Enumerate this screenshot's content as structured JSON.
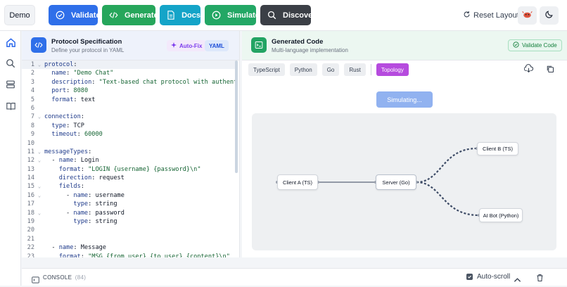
{
  "toolbar": {
    "demo_label": "Demo",
    "validate_label": "Validate",
    "generate_label": "Generate",
    "docs_label": "Docs",
    "simulate_label": "Simulate",
    "discover_label": "Discover",
    "reset_layout_label": "Reset Layout"
  },
  "sidebar": {
    "items": [
      "home-icon",
      "search-icon",
      "server-icon",
      "book-icon"
    ]
  },
  "left_panel": {
    "title": "Protocol Specification",
    "subtitle": "Define your protocol in YAML",
    "autofix_label": "Auto-Fix",
    "format_label": "YAML",
    "code_lines": [
      {
        "n": "1",
        "fold": true,
        "text": "protocol:"
      },
      {
        "n": "2",
        "fold": false,
        "text": "  name: \"Demo Chat\""
      },
      {
        "n": "3",
        "fold": false,
        "text": "  description: \"Text-based chat protocol with authenti"
      },
      {
        "n": "4",
        "fold": false,
        "text": "  port: 8080"
      },
      {
        "n": "5",
        "fold": false,
        "text": "  format: text"
      },
      {
        "n": "6",
        "fold": false,
        "text": ""
      },
      {
        "n": "7",
        "fold": true,
        "text": "connection:"
      },
      {
        "n": "8",
        "fold": false,
        "text": "  type: TCP"
      },
      {
        "n": "9",
        "fold": false,
        "text": "  timeout: 60000"
      },
      {
        "n": "10",
        "fold": false,
        "text": ""
      },
      {
        "n": "11",
        "fold": true,
        "text": "messageTypes:"
      },
      {
        "n": "12",
        "fold": true,
        "text": "  - name: Login"
      },
      {
        "n": "13",
        "fold": false,
        "text": "    format: \"LOGIN {username} {password}\\n\""
      },
      {
        "n": "14",
        "fold": false,
        "text": "    direction: request"
      },
      {
        "n": "15",
        "fold": true,
        "text": "    fields:"
      },
      {
        "n": "16",
        "fold": true,
        "text": "      - name: username"
      },
      {
        "n": "17",
        "fold": false,
        "text": "        type: string"
      },
      {
        "n": "18",
        "fold": true,
        "text": "      - name: password"
      },
      {
        "n": "19",
        "fold": false,
        "text": "        type: string"
      },
      {
        "n": "20",
        "fold": false,
        "text": ""
      },
      {
        "n": "21",
        "fold": false,
        "text": ""
      },
      {
        "n": "22",
        "fold": false,
        "text": "  - name: Message"
      },
      {
        "n": "23",
        "fold": false,
        "text": "    format: \"MSG {from_user} {to_user} {content}\\n\""
      }
    ]
  },
  "right_panel": {
    "title": "Generated Code",
    "subtitle": "Multi-language implementation",
    "validate_code_label": "Validate Code",
    "tabs": [
      "TypeScript",
      "Python",
      "Go",
      "Rust"
    ],
    "topology_label": "Topology",
    "simulating_label": "Simulating...",
    "nodes": {
      "client_a": "Client A (TS)",
      "server": "Server (Go)",
      "client_b": "Client B (TS)",
      "ai_bot": "AI Bot (Python)"
    }
  },
  "console": {
    "title": "CONSOLE",
    "count": "(84)",
    "autoscroll_label": "Auto-scroll"
  },
  "colors": {
    "validate": "#2f6fe9",
    "generate": "#26a65b",
    "docs": "#14a4c8",
    "simulate": "#23a765",
    "discover": "#3b3f46",
    "topology": "#b64bde"
  }
}
